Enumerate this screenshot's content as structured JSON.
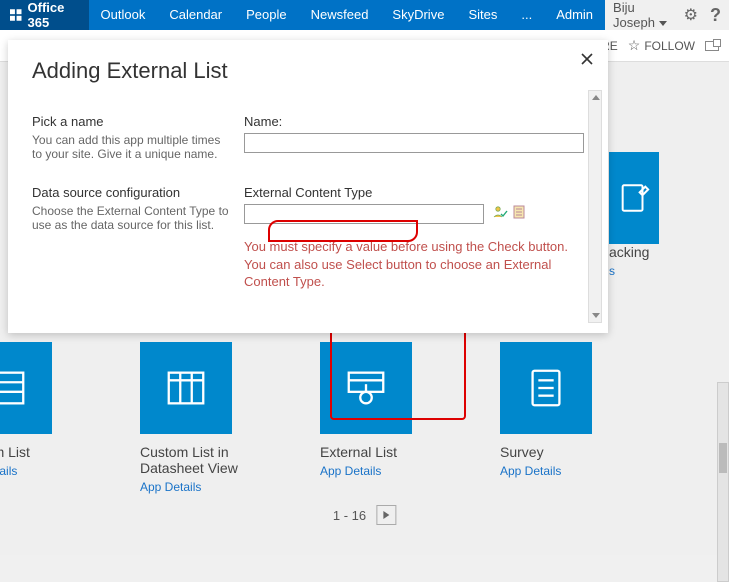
{
  "suite": {
    "brand": "Office 365",
    "links": [
      "Outlook",
      "Calendar",
      "People",
      "Newsfeed",
      "SkyDrive",
      "Sites",
      "...",
      "Admin"
    ],
    "user": "Biju Joseph"
  },
  "subbar": {
    "share_tail": "ARE",
    "follow": "FOLLOW"
  },
  "dialog": {
    "title": "Adding External List",
    "pickName": {
      "head": "Pick a name",
      "sub": "You can add this app multiple times to your site. Give it a unique name."
    },
    "nameLabel": "Name:",
    "nameValue": "",
    "dsConfig": {
      "head": "Data source configuration",
      "sub": "Choose the External Content Type to use as the data source for this list."
    },
    "ectLabel": "External Content Type",
    "ectValue": "",
    "validation": "You must specify a value before using the Check button. You can also use Select button to choose an External Content Type."
  },
  "tiles": {
    "t1": {
      "title": "Custom List",
      "link": "App Details"
    },
    "t2": {
      "title": "Custom List in Datasheet View",
      "link": "App Details"
    },
    "t3": {
      "title": "External List",
      "link": "App Details"
    },
    "t4": {
      "title": "Survey",
      "link": "App Details"
    }
  },
  "pager": "1 - 16",
  "topright_tile_tail": "acking",
  "topright_tile_tail2": "s"
}
